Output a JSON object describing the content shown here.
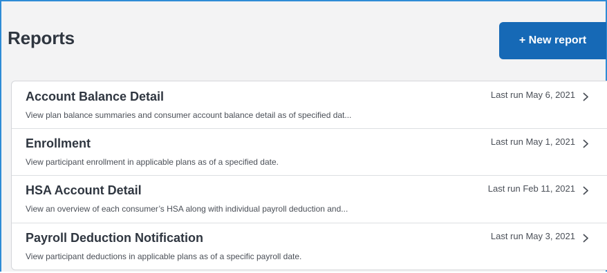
{
  "header": {
    "title": "Reports",
    "new_report_label": "+ New report"
  },
  "reports": [
    {
      "name": "Account Balance Detail",
      "description": "View plan balance summaries and consumer account balance detail as of specified dat...",
      "last_run": "Last run May 6, 2021",
      "icon": "chevron-right-icon"
    },
    {
      "name": "Enrollment",
      "description": "View participant enrollment in applicable plans as of a specified date.",
      "last_run": "Last run May 1, 2021",
      "icon": "chevron-right-icon"
    },
    {
      "name": "HSA Account Detail",
      "description": "View an overview of each consumer’s HSA along with individual payroll deduction and...",
      "last_run": "Last run Feb 11, 2021",
      "icon": "chevron-right-icon"
    },
    {
      "name": "Payroll Deduction Notification",
      "description": "View participant deductions in applicable plans as of a specific payroll date.",
      "last_run": "Last run May 3, 2021",
      "icon": "chevron-right-icon"
    }
  ],
  "colors": {
    "accent_border": "#2e8bd6",
    "button_bg": "#1669b6",
    "title_text": "#2f3640",
    "page_bg": "#f3f3f4"
  }
}
